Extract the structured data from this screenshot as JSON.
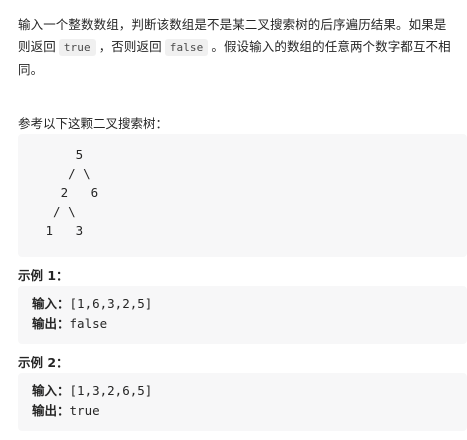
{
  "problem": {
    "description_part1": "输入一个整数数组，判断该数组是不是某二叉搜索树的后序遍历结果。如果是则返回",
    "code_true": "true",
    "description_part2": "，否则返回",
    "code_false": "false",
    "description_part3": "。假设输入的数组的任意两个数字都互不相同。",
    "reference_text": "参考以下这颗二叉搜索树：",
    "tree_lines": [
      "     5",
      "    / \\",
      "   2   6",
      "  / \\",
      " 1   3"
    ]
  },
  "examples": [
    {
      "title": "示例 1：",
      "input_label": "输入：",
      "input_value": "[1,6,3,2,5]",
      "output_label": "输出：",
      "output_value": "false"
    },
    {
      "title": "示例 2：",
      "input_label": "输入：",
      "input_value": "[1,3,2,6,5]",
      "output_label": "输出：",
      "output_value": "true"
    }
  ]
}
